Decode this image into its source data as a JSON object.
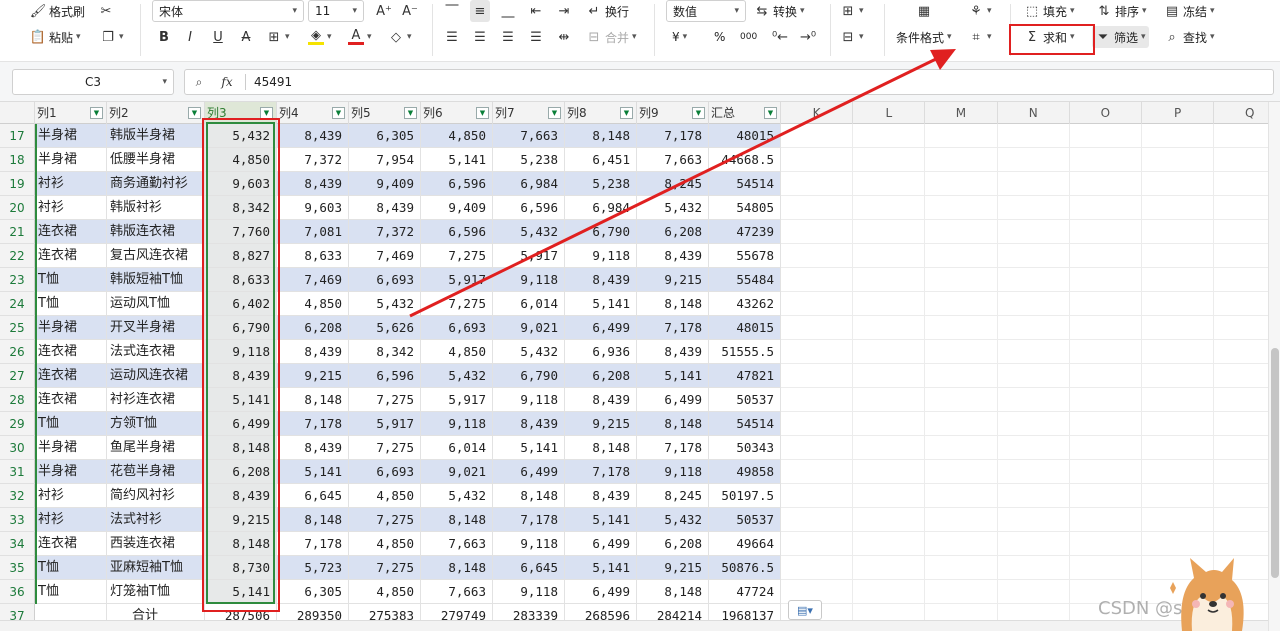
{
  "ribbon": {
    "format_painter": "格式刷",
    "paste": "粘贴",
    "font_name": "宋体",
    "font_size": "11",
    "wrap": "换行",
    "merge": "合并",
    "number_format": "数值",
    "convert": "转换",
    "currency_symbol": "¥",
    "percent_symbol": "%",
    "thousands_symbol": "000",
    "cond_format": "条件格式",
    "fill": "填充",
    "sort": "排序",
    "freeze": "冻结",
    "sum": "求和",
    "filter": "筛选",
    "find": "查找"
  },
  "formula_bar": {
    "cell_ref": "C3",
    "fx_label": "fx",
    "value": "45491"
  },
  "columns": {
    "filter_headers": [
      "列1",
      "列2",
      "列3",
      "列4",
      "列5",
      "列6",
      "列7",
      "列8",
      "列9",
      "汇总"
    ],
    "extra_letters": [
      "K",
      "L",
      "M",
      "N",
      "O",
      "P",
      "Q"
    ]
  },
  "rows": [
    {
      "n": "17",
      "c1": "半身裙",
      "c2": "韩版半身裙",
      "v": [
        "5,432",
        "8,439",
        "6,305",
        "4,850",
        "7,663",
        "8,148",
        "7,178"
      ],
      "total": "48015"
    },
    {
      "n": "18",
      "c1": "半身裙",
      "c2": "低腰半身裙",
      "v": [
        "4,850",
        "7,372",
        "7,954",
        "5,141",
        "5,238",
        "6,451",
        "7,663"
      ],
      "total": "44668.5"
    },
    {
      "n": "19",
      "c1": "衬衫",
      "c2": "商务通勤衬衫",
      "v": [
        "9,603",
        "8,439",
        "9,409",
        "6,596",
        "6,984",
        "5,238",
        "8,245"
      ],
      "total": "54514"
    },
    {
      "n": "20",
      "c1": "衬衫",
      "c2": "韩版衬衫",
      "v": [
        "8,342",
        "9,603",
        "8,439",
        "9,409",
        "6,596",
        "6,984",
        "5,432"
      ],
      "total": "54805"
    },
    {
      "n": "21",
      "c1": "连衣裙",
      "c2": "韩版连衣裙",
      "v": [
        "7,760",
        "7,081",
        "7,372",
        "6,596",
        "5,432",
        "6,790",
        "6,208"
      ],
      "total": "47239"
    },
    {
      "n": "22",
      "c1": "连衣裙",
      "c2": "复古风连衣裙",
      "v": [
        "8,827",
        "8,633",
        "7,469",
        "7,275",
        "5,917",
        "9,118",
        "8,439"
      ],
      "total": "55678"
    },
    {
      "n": "23",
      "c1": "T恤",
      "c2": "韩版短袖T恤",
      "v": [
        "8,633",
        "7,469",
        "6,693",
        "5,917",
        "9,118",
        "8,439",
        "9,215"
      ],
      "total": "55484"
    },
    {
      "n": "24",
      "c1": "T恤",
      "c2": "运动风T恤",
      "v": [
        "6,402",
        "4,850",
        "5,432",
        "7,275",
        "6,014",
        "5,141",
        "8,148"
      ],
      "total": "43262"
    },
    {
      "n": "25",
      "c1": "半身裙",
      "c2": "开叉半身裙",
      "v": [
        "6,790",
        "6,208",
        "5,626",
        "6,693",
        "9,021",
        "6,499",
        "7,178"
      ],
      "total": "48015"
    },
    {
      "n": "26",
      "c1": "连衣裙",
      "c2": "法式连衣裙",
      "v": [
        "9,118",
        "8,439",
        "8,342",
        "4,850",
        "5,432",
        "6,936",
        "8,439"
      ],
      "total": "51555.5"
    },
    {
      "n": "27",
      "c1": "连衣裙",
      "c2": "运动风连衣裙",
      "v": [
        "8,439",
        "9,215",
        "6,596",
        "5,432",
        "6,790",
        "6,208",
        "5,141"
      ],
      "total": "47821"
    },
    {
      "n": "28",
      "c1": "连衣裙",
      "c2": "衬衫连衣裙",
      "v": [
        "5,141",
        "8,148",
        "7,275",
        "5,917",
        "9,118",
        "8,439",
        "6,499"
      ],
      "total": "50537"
    },
    {
      "n": "29",
      "c1": "T恤",
      "c2": "方领T恤",
      "v": [
        "6,499",
        "7,178",
        "5,917",
        "9,118",
        "8,439",
        "9,215",
        "8,148"
      ],
      "total": "54514"
    },
    {
      "n": "30",
      "c1": "半身裙",
      "c2": "鱼尾半身裙",
      "v": [
        "8,148",
        "8,439",
        "7,275",
        "6,014",
        "5,141",
        "8,148",
        "7,178"
      ],
      "total": "50343"
    },
    {
      "n": "31",
      "c1": "半身裙",
      "c2": "花苞半身裙",
      "v": [
        "6,208",
        "5,141",
        "6,693",
        "9,021",
        "6,499",
        "7,178",
        "9,118"
      ],
      "total": "49858"
    },
    {
      "n": "32",
      "c1": "衬衫",
      "c2": "简约风衬衫",
      "v": [
        "8,439",
        "6,645",
        "4,850",
        "5,432",
        "8,148",
        "8,439",
        "8,245"
      ],
      "total": "50197.5"
    },
    {
      "n": "33",
      "c1": "衬衫",
      "c2": "法式衬衫",
      "v": [
        "9,215",
        "8,148",
        "7,275",
        "8,148",
        "7,178",
        "5,141",
        "5,432"
      ],
      "total": "50537"
    },
    {
      "n": "34",
      "c1": "连衣裙",
      "c2": "西装连衣裙",
      "v": [
        "8,148",
        "7,178",
        "4,850",
        "7,663",
        "9,118",
        "6,499",
        "6,208"
      ],
      "total": "49664"
    },
    {
      "n": "35",
      "c1": "T恤",
      "c2": "亚麻短袖T恤",
      "v": [
        "8,730",
        "5,723",
        "7,275",
        "8,148",
        "6,645",
        "5,141",
        "9,215"
      ],
      "total": "50876.5"
    },
    {
      "n": "36",
      "c1": "T恤",
      "c2": "灯笼袖T恤",
      "v": [
        "5,141",
        "6,305",
        "4,850",
        "7,663",
        "9,118",
        "6,499",
        "8,148"
      ],
      "total": "47724"
    }
  ],
  "total_row": {
    "n": "37",
    "label": "合计",
    "values": [
      "287506",
      "289350",
      "275383",
      "279749",
      "283339",
      "268596",
      "284214",
      "1968137"
    ]
  },
  "watermark": "CSDN @shelian",
  "colors": {
    "band": "#d9e1f2",
    "selection": "#2e8b3e",
    "annotation": "#e02020"
  }
}
